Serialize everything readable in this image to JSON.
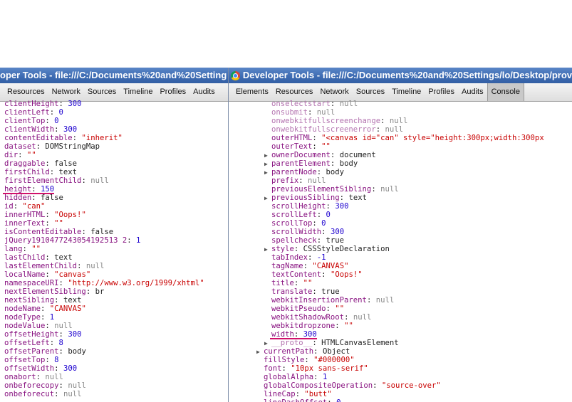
{
  "left_window": {
    "title": "oper Tools - file:///C:/Documents%20and%20Setting",
    "tabs": [
      "Resources",
      "Network",
      "Sources",
      "Timeline",
      "Profiles",
      "Audits"
    ],
    "props": [
      {
        "k": "clientHeight",
        "v": "300",
        "t": "num"
      },
      {
        "k": "clientLeft",
        "v": "0",
        "t": "num"
      },
      {
        "k": "clientTop",
        "v": "0",
        "t": "num"
      },
      {
        "k": "clientWidth",
        "v": "300",
        "t": "num"
      },
      {
        "k": "contentEditable",
        "v": "\"inherit\"",
        "t": "str"
      },
      {
        "k": "dataset",
        "v": "DOMStringMap",
        "t": "obj"
      },
      {
        "k": "dir",
        "v": "\"\"",
        "t": "str"
      },
      {
        "k": "draggable",
        "v": "false",
        "t": "obj"
      },
      {
        "k": "firstChild",
        "v": "text",
        "t": "obj"
      },
      {
        "k": "firstElementChild",
        "v": "null",
        "t": "null"
      },
      {
        "k": "height",
        "v": "150",
        "t": "num"
      },
      {
        "k": "hidden",
        "v": "false",
        "t": "obj"
      },
      {
        "k": "id",
        "v": "\"can\"",
        "t": "str"
      },
      {
        "k": "innerHTML",
        "v": "\"Oops!\"",
        "t": "str"
      },
      {
        "k": "innerText",
        "v": "\"\"",
        "t": "str"
      },
      {
        "k": "isContentEditable",
        "v": "false",
        "t": "obj"
      },
      {
        "k": "jQuery1910477243054192513 2",
        "v": "1",
        "t": "num"
      },
      {
        "k": "lang",
        "v": "\"\"",
        "t": "str"
      },
      {
        "k": "lastChild",
        "v": "text",
        "t": "obj"
      },
      {
        "k": "lastElementChild",
        "v": "null",
        "t": "null"
      },
      {
        "k": "localName",
        "v": "\"canvas\"",
        "t": "str"
      },
      {
        "k": "namespaceURI",
        "v": "\"http://www.w3.org/1999/xhtml\"",
        "t": "str"
      },
      {
        "k": "nextElementSibling",
        "v": "br",
        "t": "obj"
      },
      {
        "k": "nextSibling",
        "v": "text",
        "t": "obj"
      },
      {
        "k": "nodeName",
        "v": "\"CANVAS\"",
        "t": "str"
      },
      {
        "k": "nodeType",
        "v": "1",
        "t": "num"
      },
      {
        "k": "nodeValue",
        "v": "null",
        "t": "null"
      },
      {
        "k": "offsetHeight",
        "v": "300",
        "t": "num"
      },
      {
        "k": "offsetLeft",
        "v": "8",
        "t": "num"
      },
      {
        "k": "offsetParent",
        "v": "body",
        "t": "obj"
      },
      {
        "k": "offsetTop",
        "v": "8",
        "t": "num"
      },
      {
        "k": "offsetWidth",
        "v": "300",
        "t": "num"
      },
      {
        "k": "onabort",
        "v": "null",
        "t": "null"
      },
      {
        "k": "onbeforecopy",
        "v": "null",
        "t": "null"
      },
      {
        "k": "onbeforecut",
        "v": "null",
        "t": "null"
      }
    ]
  },
  "right_window": {
    "title": "Developer Tools - file:///C:/Documents%20and%20Settings/lo/Desktop/prov",
    "tabs": [
      "Elements",
      "Resources",
      "Network",
      "Sources",
      "Timeline",
      "Profiles",
      "Audits",
      "Console"
    ],
    "selected_tab": "Console",
    "props": [
      {
        "k": "onselectstart",
        "v": "null",
        "t": "null",
        "dim": true
      },
      {
        "k": "onsubmit",
        "v": "null",
        "t": "null",
        "dim": true
      },
      {
        "k": "onwebkitfullscreenchange",
        "v": "null",
        "t": "null",
        "dim": true
      },
      {
        "k": "onwebkitfullscreenerror",
        "v": "null",
        "t": "null",
        "dim": true
      },
      {
        "k": "outerHTML",
        "v": "\"<canvas id=\"can\" style=\"height:300px;width:300px",
        "t": "str"
      },
      {
        "k": "outerText",
        "v": "\"\"",
        "t": "str"
      },
      {
        "k": "ownerDocument",
        "v": "document",
        "t": "obj",
        "arrow": true
      },
      {
        "k": "parentElement",
        "v": "body",
        "t": "obj",
        "arrow": true
      },
      {
        "k": "parentNode",
        "v": "body",
        "t": "obj",
        "arrow": true
      },
      {
        "k": "prefix",
        "v": "null",
        "t": "null"
      },
      {
        "k": "previousElementSibling",
        "v": "null",
        "t": "null"
      },
      {
        "k": "previousSibling",
        "v": "text",
        "t": "obj",
        "arrow": true
      },
      {
        "k": "scrollHeight",
        "v": "300",
        "t": "num"
      },
      {
        "k": "scrollLeft",
        "v": "0",
        "t": "num"
      },
      {
        "k": "scrollTop",
        "v": "0",
        "t": "num"
      },
      {
        "k": "scrollWidth",
        "v": "300",
        "t": "num"
      },
      {
        "k": "spellcheck",
        "v": "true",
        "t": "obj"
      },
      {
        "k": "style",
        "v": "CSSStyleDeclaration",
        "t": "obj",
        "arrow": true
      },
      {
        "k": "tabIndex",
        "v": "-1",
        "t": "num"
      },
      {
        "k": "tagName",
        "v": "\"CANVAS\"",
        "t": "str"
      },
      {
        "k": "textContent",
        "v": "\"Oops!\"",
        "t": "str"
      },
      {
        "k": "title",
        "v": "\"\"",
        "t": "str"
      },
      {
        "k": "translate",
        "v": "true",
        "t": "obj"
      },
      {
        "k": "webkitInsertionParent",
        "v": "null",
        "t": "null"
      },
      {
        "k": "webkitPseudo",
        "v": "\"\"",
        "t": "str"
      },
      {
        "k": "webkitShadowRoot",
        "v": "null",
        "t": "null"
      },
      {
        "k": "webkitdropzone",
        "v": "\"\"",
        "t": "str"
      },
      {
        "k": "width",
        "v": "300",
        "t": "num"
      },
      {
        "k": "__proto__",
        "v": "HTMLCanvasElement",
        "t": "obj",
        "arrow": true,
        "dim": true
      },
      {
        "k": "currentPath",
        "v": "Object",
        "t": "obj",
        "arrow": true,
        "outer": true
      },
      {
        "k": "fillStyle",
        "v": "\"#000000\"",
        "t": "str",
        "outer": true
      },
      {
        "k": "font",
        "v": "\"10px sans-serif\"",
        "t": "str",
        "outer": true
      },
      {
        "k": "globalAlpha",
        "v": "1",
        "t": "num",
        "outer": true
      },
      {
        "k": "globalCompositeOperation",
        "v": "\"source-over\"",
        "t": "str",
        "outer": true
      },
      {
        "k": "lineCap",
        "v": "\"butt\"",
        "t": "str",
        "outer": true
      },
      {
        "k": "lineDashOffset",
        "v": "0",
        "t": "num",
        "outer": true
      }
    ]
  },
  "highlights": {
    "left_key": "height",
    "right_key": "width",
    "color": "#d0106b"
  }
}
